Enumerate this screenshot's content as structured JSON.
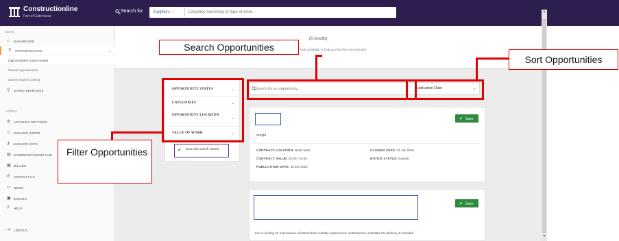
{
  "app": {
    "brand": "Constructionline",
    "brand_sub": "Part of Gatehouse"
  },
  "topbar": {
    "search_for_label": "Search for",
    "category_select": "Suppliers",
    "search_placeholder": "Company name/reg or type of work..."
  },
  "sidebar": {
    "main_section": "MAIN",
    "admin_section": "ADMIN",
    "items": [
      {
        "label": "DASHBOARD",
        "icon": "home-icon"
      },
      {
        "label": "OPPORTUNITIES",
        "icon": "filter-icon"
      },
      {
        "label": "Opportunities notice board"
      },
      {
        "label": "Saved opportunities"
      },
      {
        "label": "Saved search criteria"
      },
      {
        "label": "SAVED SEARCHES",
        "icon": "search-icon"
      }
    ],
    "admin_items": [
      {
        "label": "ACCOUNT SETTINGS",
        "icon": "gear-icon"
      },
      {
        "label": "MANAGE USERS",
        "icon": "users-icon"
      },
      {
        "label": "MANAGE KEYS",
        "icon": "key-icon"
      },
      {
        "label": "COMMUNICATIONS HUB",
        "icon": "chat-icon"
      },
      {
        "label": "BILLING",
        "icon": "billing-icon"
      },
      {
        "label": "CONTACT US",
        "icon": "phone-icon"
      },
      {
        "label": "NEWS",
        "icon": "news-icon"
      },
      {
        "label": "EVENTS",
        "icon": "calendar-icon"
      },
      {
        "label": "HELP",
        "icon": "help-icon"
      },
      {
        "label": "LOGOUT",
        "icon": "logout-icon"
      }
    ]
  },
  "main": {
    "results_count": "(6 results)",
    "description": "tools available to help you find the most relevant",
    "filters": [
      "OPPORTUNITY STATUS",
      "CATEGORIES",
      "OPPORTUNITY LOCATION",
      "VALUE OF WORK"
    ],
    "save_search_label": "Save this search criteria",
    "opp_search_placeholder": "Search for an opportunity...",
    "sort_value": "Publication Date",
    "save_label": "Save",
    "cards": [
      {
        "name": "sunjkl",
        "contract_location_label": "CONTRACT LOCATION:",
        "contract_location": "North West",
        "contract_value_label": "CONTRACT VALUE:",
        "contract_value": "£0.00 - £0.00,",
        "publication_date_label": "PUBLICATION DATE:",
        "publication_date": "16 Jun 2016",
        "closing_date_label": "CLOSING DATE:",
        "closing_date": "31 Jan 2016",
        "notice_status_label": "NOTICE STATUS:",
        "notice_status": "Expired"
      },
      {
        "description": "Kier is looking for expressions of interest from suitably experienced contractors to undertake the delivery of remedial"
      }
    ]
  },
  "annotations": {
    "search": "Search Opportunities",
    "sort": "Sort Opportunities",
    "filter": "Filter Opportunities"
  },
  "colors": {
    "topbar": "#2e1d4f",
    "accent_purple": "#5a2f86",
    "save_green": "#2f8a3e",
    "annotation_red": "#e10000",
    "active_marker": "#f29b1d"
  }
}
